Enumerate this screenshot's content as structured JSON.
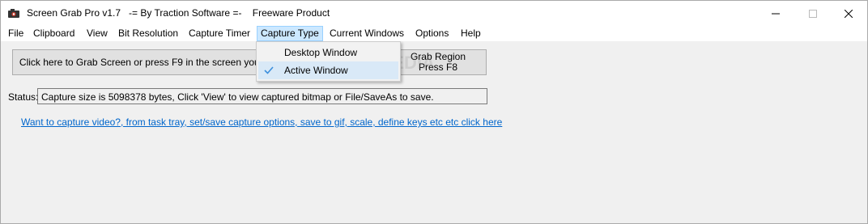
{
  "window": {
    "title": "Screen Grab Pro v1.7   -= By Traction Software =-    Freeware Product",
    "app_icon": "camera-icon",
    "controls": {
      "minimize": "minimize-icon",
      "maximize": "maximize-icon",
      "close": "close-icon"
    }
  },
  "menu": {
    "items": [
      {
        "label": "File"
      },
      {
        "label": "Clipboard"
      },
      {
        "label": "View"
      },
      {
        "label": "Bit Resolution"
      },
      {
        "label": "Capture Timer"
      },
      {
        "label": "Capture Type",
        "open": true
      },
      {
        "label": "Current Windows"
      },
      {
        "label": "Options"
      },
      {
        "label": "Help"
      }
    ]
  },
  "dropdown": {
    "items": [
      {
        "label": "Desktop Window",
        "checked": false
      },
      {
        "label": "Active Window",
        "checked": true
      }
    ]
  },
  "main": {
    "grab_button": "Click here to Grab Screen or press F9 in the screen you want to capture",
    "region_button": {
      "line1": "Grab Region",
      "line2": "Press F8"
    },
    "status_label": "Status:",
    "status_text": "Capture size is 5098378 bytes, Click 'View' to view captured bitmap or File/SaveAs to save.",
    "link_text": "Want to capture video?, from task tray, set/save capture options, save to gif, scale, define keys etc etc click here"
  },
  "watermark": "SOFTPEDIA",
  "colors": {
    "menu_highlight": "#cce8ff",
    "link": "#0066cc",
    "check": "#3c8fdc"
  }
}
